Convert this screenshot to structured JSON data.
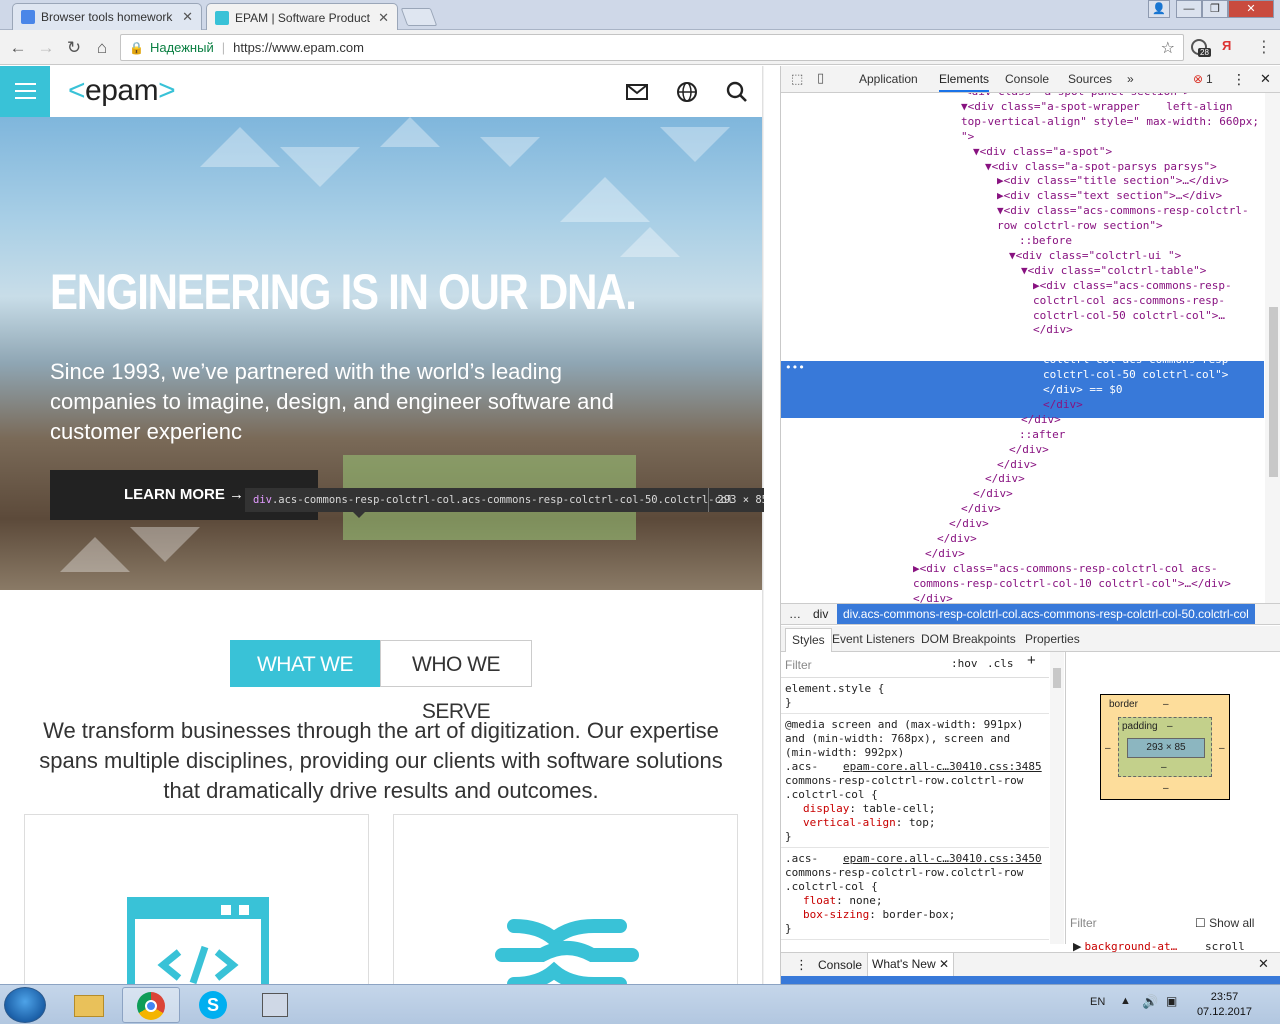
{
  "browser": {
    "tabs": [
      {
        "label": "Browser tools homework",
        "active": false
      },
      {
        "label": "EPAM | Software Product",
        "active": true
      }
    ],
    "address": {
      "secure_label": "Надежный",
      "url": "https://www.epam.com"
    },
    "extension_badge": "28",
    "ext2_label": "Я"
  },
  "site": {
    "logo": "epam",
    "hero": {
      "heading": "ENGINEERING IS IN OUR DNA.",
      "subheading": "Since 1993, we’ve partnered with the world’s leading companies to imagine, design, and engineer software and customer experienc",
      "cta": "LEARN MORE →"
    },
    "tabs": [
      "WHAT WE DO",
      "WHO WE SERVE"
    ],
    "intro": "We transform businesses through the art of digitization. Our expertise spans multiple disciplines, providing our clients with software solutions that dramatically drive results and outcomes."
  },
  "inspector_tooltip": {
    "tag": "div",
    "selector": ".acs-commons-resp-colctrl-col.acs-commons-resp-colctrl-col-50.colctrl-col",
    "size": "293 × 85"
  },
  "devtools": {
    "tabs": [
      "Application",
      "Elements",
      "Console",
      "Sources",
      "»"
    ],
    "active_tab": "Elements",
    "error_count": "1",
    "dom_lines": [
      {
        "indent": 968,
        "text": "<div class=\"a-spot panel section\">"
      },
      {
        "indent": 964,
        "text": "▼<div class=\"a-spot-wrapper    left-align"
      },
      {
        "indent": 964,
        "text": "top-vertical-align\" style=\" max-width: 660px;"
      },
      {
        "indent": 964,
        "text": "\">"
      },
      {
        "indent": 976,
        "text": "▼<div class=\"a-spot\">"
      },
      {
        "indent": 988,
        "text": "▼<div class=\"a-spot-parsys parsys\">"
      },
      {
        "indent": 1000,
        "text": "▶<div class=\"title section\">…</div>"
      },
      {
        "indent": 1000,
        "text": "▶<div class=\"text section\">…</div>"
      },
      {
        "indent": 1000,
        "text": "▼<div class=\"acs-commons-resp-colctrl-"
      },
      {
        "indent": 1000,
        "text": "row colctrl-row section\">"
      },
      {
        "indent": 1022,
        "text": "::before"
      },
      {
        "indent": 1012,
        "text": "▼<div class=\"colctrl-ui \">"
      },
      {
        "indent": 1024,
        "text": "▼<div class=\"colctrl-table\">"
      },
      {
        "indent": 1036,
        "text": "▶<div class=\"acs-commons-resp-"
      },
      {
        "indent": 1036,
        "text": "colctrl-col acs-commons-resp-"
      },
      {
        "indent": 1036,
        "text": "colctrl-col-50 colctrl-col\">…"
      },
      {
        "indent": 1036,
        "text": "</div>"
      },
      {
        "indent": 1046,
        "text": "<div class=\"acs-commons-resp-"
      },
      {
        "indent": 1046,
        "text": "colctrl-col acs-commons-resp-"
      },
      {
        "indent": 1046,
        "text": "colctrl-col-50 colctrl-col\">"
      },
      {
        "indent": 1046,
        "text": "</div> == $0"
      },
      {
        "indent": 1046,
        "text": "</div>"
      },
      {
        "indent": 1024,
        "text": "</div>"
      },
      {
        "indent": 1022,
        "text": "::after"
      },
      {
        "indent": 1012,
        "text": "</div>"
      },
      {
        "indent": 1000,
        "text": "</div>"
      },
      {
        "indent": 988,
        "text": "</div>"
      },
      {
        "indent": 976,
        "text": "</div>"
      },
      {
        "indent": 964,
        "text": "</div>"
      },
      {
        "indent": 952,
        "text": "</div>"
      },
      {
        "indent": 940,
        "text": "</div>"
      },
      {
        "indent": 928,
        "text": "</div>"
      },
      {
        "indent": 916,
        "text": "▶<div class=\"acs-commons-resp-colctrl-col acs-"
      },
      {
        "indent": 916,
        "text": "commons-resp-colctrl-col-10 colctrl-col\">…</div>"
      },
      {
        "indent": 916,
        "text": "</div>"
      }
    ],
    "breadcrumb": [
      "…",
      "div",
      "div.acs-commons-resp-colctrl-col.acs-commons-resp-colctrl-col-50.colctrl-col"
    ],
    "styles_tabs": [
      "Styles",
      "Event Listeners",
      "DOM Breakpoints",
      "Properties"
    ],
    "filter_placeholder": "Filter",
    "filter_toggles": [
      ":hov",
      ".cls",
      "+"
    ],
    "rules": [
      {
        "lines": [
          "element.style {",
          "}"
        ]
      },
      {
        "lines": [
          "@media screen and (max-width: 991px)",
          "and (min-width: 768px), screen and",
          "(min-width: 992px)",
          ".acs-",
          "commons-resp-colctrl-row.colctrl-row",
          ".colctrl-col {"
        ],
        "link": "epam-core.all-c…30410.css:3485",
        "props": [
          [
            "display",
            "table-cell;"
          ],
          [
            "vertical-align",
            "top;"
          ]
        ],
        "close": "}"
      },
      {
        "lines": [
          ".acs-",
          "commons-resp-colctrl-row.colctrl-row",
          ".colctrl-col {"
        ],
        "link": "epam-core.all-c…30410.css:3450",
        "props": [
          [
            "float",
            "none;"
          ],
          [
            "box-sizing",
            "border-box;"
          ]
        ],
        "close": "}"
      }
    ],
    "box_model": {
      "border_label": "border",
      "padding_label": "padding",
      "dash": "–",
      "content": "293 × 85"
    },
    "computed_filter": "Filter",
    "show_all": "Show all",
    "computed": [
      {
        "name": "background-at…",
        "value": "scroll"
      },
      {
        "name": "background-cl…",
        "value": "border-…"
      },
      {
        "name": "background-co…",
        "value": "rgba(0,"
      },
      {
        "name": "background-im…",
        "value": "none"
      },
      {
        "name": "background-or…",
        "value": "padding…"
      }
    ],
    "drawer_tabs": [
      "Console",
      "What's New"
    ]
  },
  "taskbar": {
    "lang": "EN",
    "time": "23:57",
    "date": "07.12.2017"
  },
  "colors": {
    "accent": "#39c2d7",
    "devtools_selection": "#3879d9"
  }
}
